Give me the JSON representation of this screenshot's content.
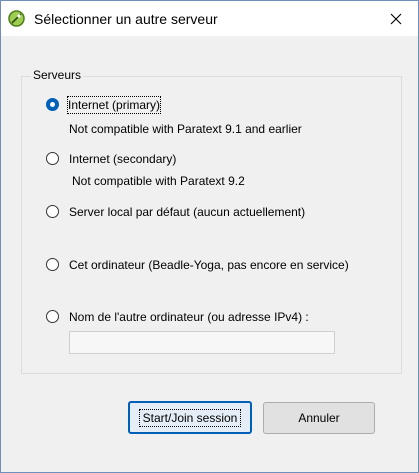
{
  "window": {
    "title": "Sélectionner un autre serveur",
    "close_glyph": "✕",
    "icon": "app-circle-icon"
  },
  "group": {
    "label": "Serveurs"
  },
  "options": [
    {
      "label": "Internet (primary)",
      "sublabel": "Not compatible with Paratext 9.1 and earlier",
      "selected": true
    },
    {
      "label": "Internet (secondary)",
      "sublabel": "Not compatible with Paratext 9.2",
      "selected": false
    },
    {
      "label": "Server local par défaut (aucun actuellement)",
      "selected": false
    },
    {
      "label": "Cet ordinateur (Beadle-Yoga, pas encore en service)",
      "selected": false
    },
    {
      "label": "Nom de l'autre ordinateur (ou adresse IPv4) :",
      "selected": false
    }
  ],
  "other_computer": {
    "value": "",
    "placeholder": ""
  },
  "buttons": {
    "start_join": "Start/Join session",
    "cancel": "Annuler"
  },
  "colors": {
    "accent": "#005fb8",
    "icon_green": "#8cbf3f"
  }
}
